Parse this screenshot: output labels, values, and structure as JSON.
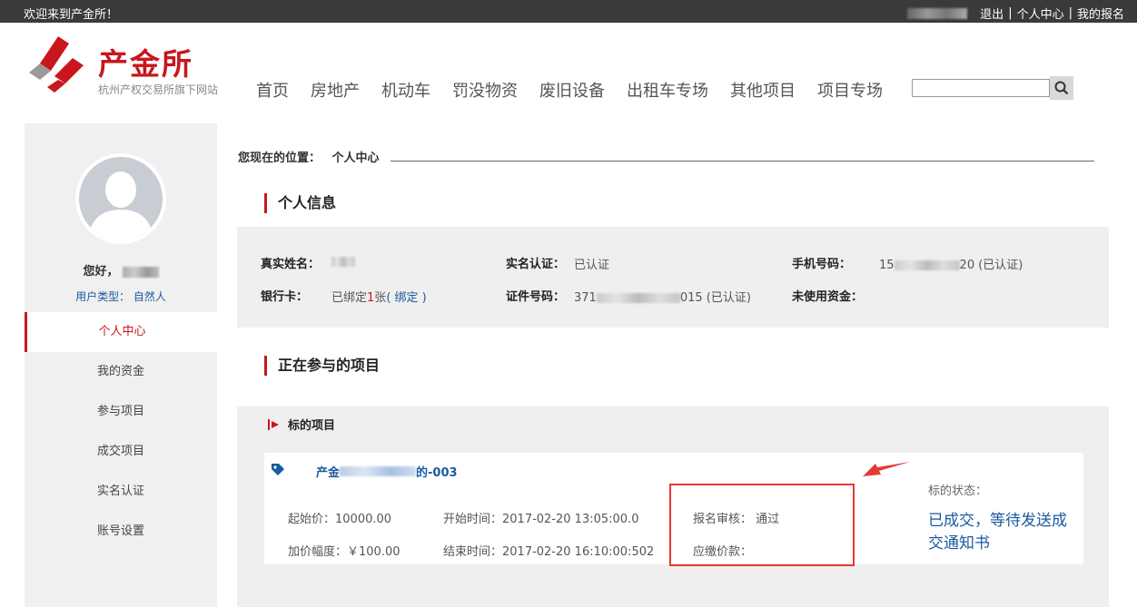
{
  "topbar": {
    "welcome": "欢迎来到产金所！",
    "links": [
      "退出",
      "个人中心",
      "我的报名"
    ],
    "separator": "|"
  },
  "logo": {
    "name": "产金所",
    "tagline": "杭州产权交易所旗下网站"
  },
  "nav": [
    "首页",
    "房地产",
    "机动车",
    "罚没物资",
    "废旧设备",
    "出租车专场",
    "其他项目",
    "项目专场"
  ],
  "search": {
    "value": "",
    "icon": "search-icon"
  },
  "sidebar": {
    "hello": "您好，",
    "user_type": "用户类型： 自然人",
    "menu": [
      "个人中心",
      "我的资金",
      "参与项目",
      "成交项目",
      "实名认证",
      "账号设置"
    ],
    "active_index": 0
  },
  "breadcrumb": {
    "label": "您现在的位置：",
    "current": "个人中心"
  },
  "personal": {
    "title": "个人信息",
    "real_name_label": "真实姓名：",
    "verify_label": "实名认证：",
    "verify_value": "已认证",
    "phone_label": "手机号码：",
    "phone_prefix": "15",
    "phone_suffix": "20",
    "phone_status": "(已认证)",
    "bank_label": "银行卡：",
    "bank_prefix": "已绑定",
    "bank_count": "1",
    "bank_suffix": "张",
    "bank_link": "( 绑定 )",
    "id_label": "证件号码：",
    "id_prefix": "371",
    "id_suffix": "015",
    "id_status": "(已认证)",
    "funds_label": "未使用资金："
  },
  "projects": {
    "title": "正在参与的项目",
    "group": "标的项目",
    "item": {
      "title_prefix": "产金",
      "title_suffix": "的-003",
      "start_price": "起始价：10000.00",
      "increment": "加价幅度：￥100.00",
      "start_time": "开始时间：2017-02-20 13:05:00.0",
      "end_time": "结束时间：2017-02-20 16:10:00:502",
      "review": "报名审核：  通过",
      "deposit": "应缴价款：",
      "status_label": "标的状态：",
      "status_value": "已成交，等待发送成交通知书"
    }
  },
  "colors": {
    "brand_red": "#c9161d",
    "link_blue": "#1a5aa0",
    "topbar": "#3a3a3a",
    "highlight": "#e53935"
  }
}
